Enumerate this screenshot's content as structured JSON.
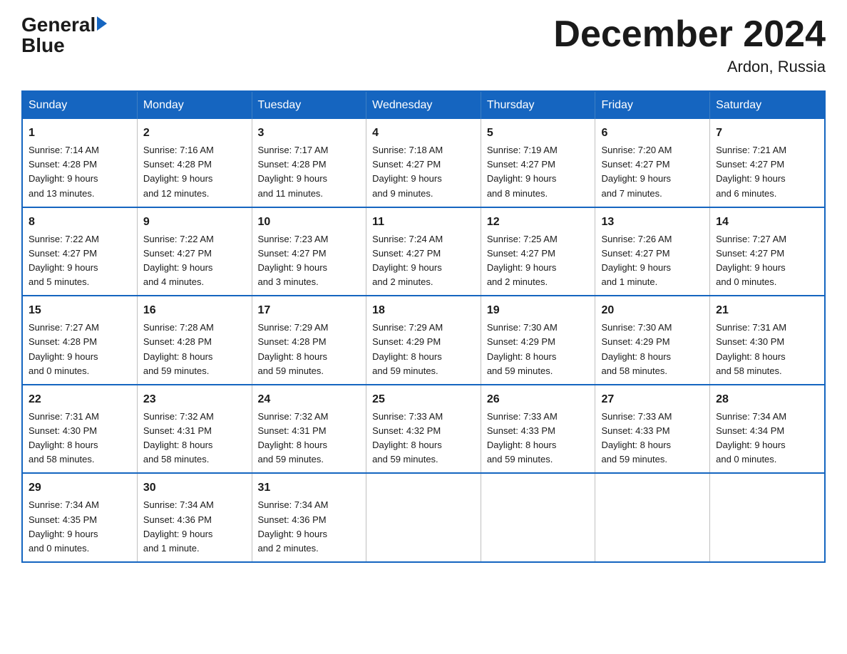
{
  "logo": {
    "text_general": "General",
    "text_blue": "Blue",
    "arrow": "▶"
  },
  "title": "December 2024",
  "location": "Ardon, Russia",
  "headers": [
    "Sunday",
    "Monday",
    "Tuesday",
    "Wednesday",
    "Thursday",
    "Friday",
    "Saturday"
  ],
  "weeks": [
    [
      {
        "day": "1",
        "info": "Sunrise: 7:14 AM\nSunset: 4:28 PM\nDaylight: 9 hours\nand 13 minutes."
      },
      {
        "day": "2",
        "info": "Sunrise: 7:16 AM\nSunset: 4:28 PM\nDaylight: 9 hours\nand 12 minutes."
      },
      {
        "day": "3",
        "info": "Sunrise: 7:17 AM\nSunset: 4:28 PM\nDaylight: 9 hours\nand 11 minutes."
      },
      {
        "day": "4",
        "info": "Sunrise: 7:18 AM\nSunset: 4:27 PM\nDaylight: 9 hours\nand 9 minutes."
      },
      {
        "day": "5",
        "info": "Sunrise: 7:19 AM\nSunset: 4:27 PM\nDaylight: 9 hours\nand 8 minutes."
      },
      {
        "day": "6",
        "info": "Sunrise: 7:20 AM\nSunset: 4:27 PM\nDaylight: 9 hours\nand 7 minutes."
      },
      {
        "day": "7",
        "info": "Sunrise: 7:21 AM\nSunset: 4:27 PM\nDaylight: 9 hours\nand 6 minutes."
      }
    ],
    [
      {
        "day": "8",
        "info": "Sunrise: 7:22 AM\nSunset: 4:27 PM\nDaylight: 9 hours\nand 5 minutes."
      },
      {
        "day": "9",
        "info": "Sunrise: 7:22 AM\nSunset: 4:27 PM\nDaylight: 9 hours\nand 4 minutes."
      },
      {
        "day": "10",
        "info": "Sunrise: 7:23 AM\nSunset: 4:27 PM\nDaylight: 9 hours\nand 3 minutes."
      },
      {
        "day": "11",
        "info": "Sunrise: 7:24 AM\nSunset: 4:27 PM\nDaylight: 9 hours\nand 2 minutes."
      },
      {
        "day": "12",
        "info": "Sunrise: 7:25 AM\nSunset: 4:27 PM\nDaylight: 9 hours\nand 2 minutes."
      },
      {
        "day": "13",
        "info": "Sunrise: 7:26 AM\nSunset: 4:27 PM\nDaylight: 9 hours\nand 1 minute."
      },
      {
        "day": "14",
        "info": "Sunrise: 7:27 AM\nSunset: 4:27 PM\nDaylight: 9 hours\nand 0 minutes."
      }
    ],
    [
      {
        "day": "15",
        "info": "Sunrise: 7:27 AM\nSunset: 4:28 PM\nDaylight: 9 hours\nand 0 minutes."
      },
      {
        "day": "16",
        "info": "Sunrise: 7:28 AM\nSunset: 4:28 PM\nDaylight: 8 hours\nand 59 minutes."
      },
      {
        "day": "17",
        "info": "Sunrise: 7:29 AM\nSunset: 4:28 PM\nDaylight: 8 hours\nand 59 minutes."
      },
      {
        "day": "18",
        "info": "Sunrise: 7:29 AM\nSunset: 4:29 PM\nDaylight: 8 hours\nand 59 minutes."
      },
      {
        "day": "19",
        "info": "Sunrise: 7:30 AM\nSunset: 4:29 PM\nDaylight: 8 hours\nand 59 minutes."
      },
      {
        "day": "20",
        "info": "Sunrise: 7:30 AM\nSunset: 4:29 PM\nDaylight: 8 hours\nand 58 minutes."
      },
      {
        "day": "21",
        "info": "Sunrise: 7:31 AM\nSunset: 4:30 PM\nDaylight: 8 hours\nand 58 minutes."
      }
    ],
    [
      {
        "day": "22",
        "info": "Sunrise: 7:31 AM\nSunset: 4:30 PM\nDaylight: 8 hours\nand 58 minutes."
      },
      {
        "day": "23",
        "info": "Sunrise: 7:32 AM\nSunset: 4:31 PM\nDaylight: 8 hours\nand 58 minutes."
      },
      {
        "day": "24",
        "info": "Sunrise: 7:32 AM\nSunset: 4:31 PM\nDaylight: 8 hours\nand 59 minutes."
      },
      {
        "day": "25",
        "info": "Sunrise: 7:33 AM\nSunset: 4:32 PM\nDaylight: 8 hours\nand 59 minutes."
      },
      {
        "day": "26",
        "info": "Sunrise: 7:33 AM\nSunset: 4:33 PM\nDaylight: 8 hours\nand 59 minutes."
      },
      {
        "day": "27",
        "info": "Sunrise: 7:33 AM\nSunset: 4:33 PM\nDaylight: 8 hours\nand 59 minutes."
      },
      {
        "day": "28",
        "info": "Sunrise: 7:34 AM\nSunset: 4:34 PM\nDaylight: 9 hours\nand 0 minutes."
      }
    ],
    [
      {
        "day": "29",
        "info": "Sunrise: 7:34 AM\nSunset: 4:35 PM\nDaylight: 9 hours\nand 0 minutes."
      },
      {
        "day": "30",
        "info": "Sunrise: 7:34 AM\nSunset: 4:36 PM\nDaylight: 9 hours\nand 1 minute."
      },
      {
        "day": "31",
        "info": "Sunrise: 7:34 AM\nSunset: 4:36 PM\nDaylight: 9 hours\nand 2 minutes."
      },
      {
        "day": "",
        "info": ""
      },
      {
        "day": "",
        "info": ""
      },
      {
        "day": "",
        "info": ""
      },
      {
        "day": "",
        "info": ""
      }
    ]
  ]
}
